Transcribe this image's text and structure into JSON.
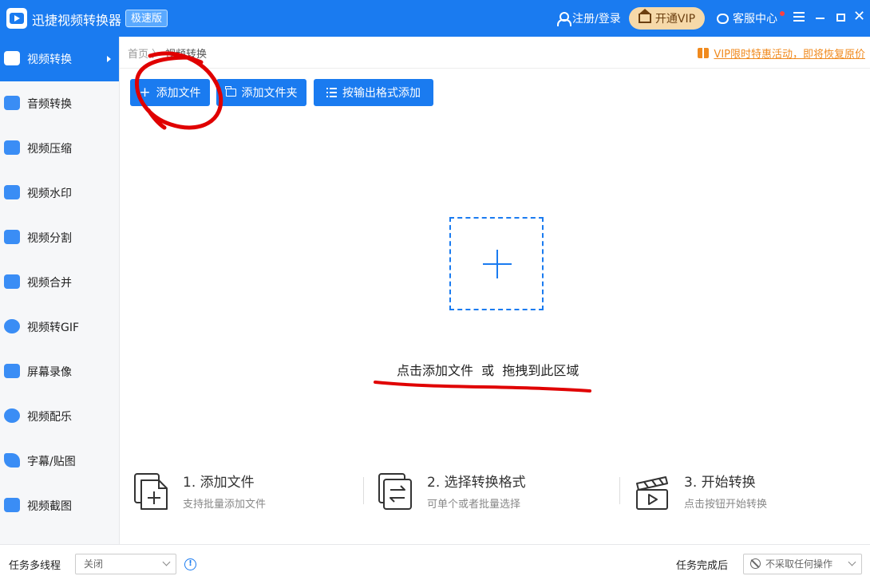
{
  "titlebar": {
    "app_title": "迅捷视频转换器",
    "edition_badge": "极速版",
    "login_label": "注册/登录",
    "vip_label": "开通VIP",
    "service_label": "客服中心"
  },
  "colors": {
    "brand": "#1a7bf0",
    "promo": "#f08a1e",
    "annotation": "#e00000",
    "vip_bg": "#f6d9a9"
  },
  "sidebar": {
    "items": [
      {
        "label": "视频转换",
        "icon": "video-convert-icon",
        "active": true
      },
      {
        "label": "音频转换",
        "icon": "audio-convert-icon"
      },
      {
        "label": "视频压缩",
        "icon": "video-compress-icon"
      },
      {
        "label": "视频水印",
        "icon": "video-watermark-icon"
      },
      {
        "label": "视频分割",
        "icon": "video-split-icon"
      },
      {
        "label": "视频合并",
        "icon": "video-merge-icon"
      },
      {
        "label": "视频转GIF",
        "icon": "video-gif-icon"
      },
      {
        "label": "屏幕录像",
        "icon": "screen-record-icon"
      },
      {
        "label": "视频配乐",
        "icon": "video-music-icon"
      },
      {
        "label": "字幕/贴图",
        "icon": "subtitle-sticker-icon"
      },
      {
        "label": "视频截图",
        "icon": "video-screenshot-icon"
      }
    ]
  },
  "breadcrumb": {
    "home": "首页",
    "separator": "〉",
    "current": "视频转换"
  },
  "promo": "VIP限时特惠活动，即将恢复原价",
  "toolbar": {
    "add_file": "添加文件",
    "add_folder": "添加文件夹",
    "add_by_format": "按输出格式添加"
  },
  "drop_zone": {
    "hint": "点击添加文件  或  拖拽到此区域"
  },
  "steps": [
    {
      "title": "1. 添加文件",
      "subtitle": "支持批量添加文件",
      "icon": "add-files-icon"
    },
    {
      "title": "2. 选择转换格式",
      "subtitle": "可单个或者批量选择",
      "icon": "format-switch-icon"
    },
    {
      "title": "3. 开始转换",
      "subtitle": "点击按钮开始转换",
      "icon": "clapperboard-icon"
    }
  ],
  "footer": {
    "multithread_label": "任务多线程",
    "multithread_value": "关闭",
    "after_done_label": "任务完成后",
    "after_done_value": "不采取任何操作"
  }
}
